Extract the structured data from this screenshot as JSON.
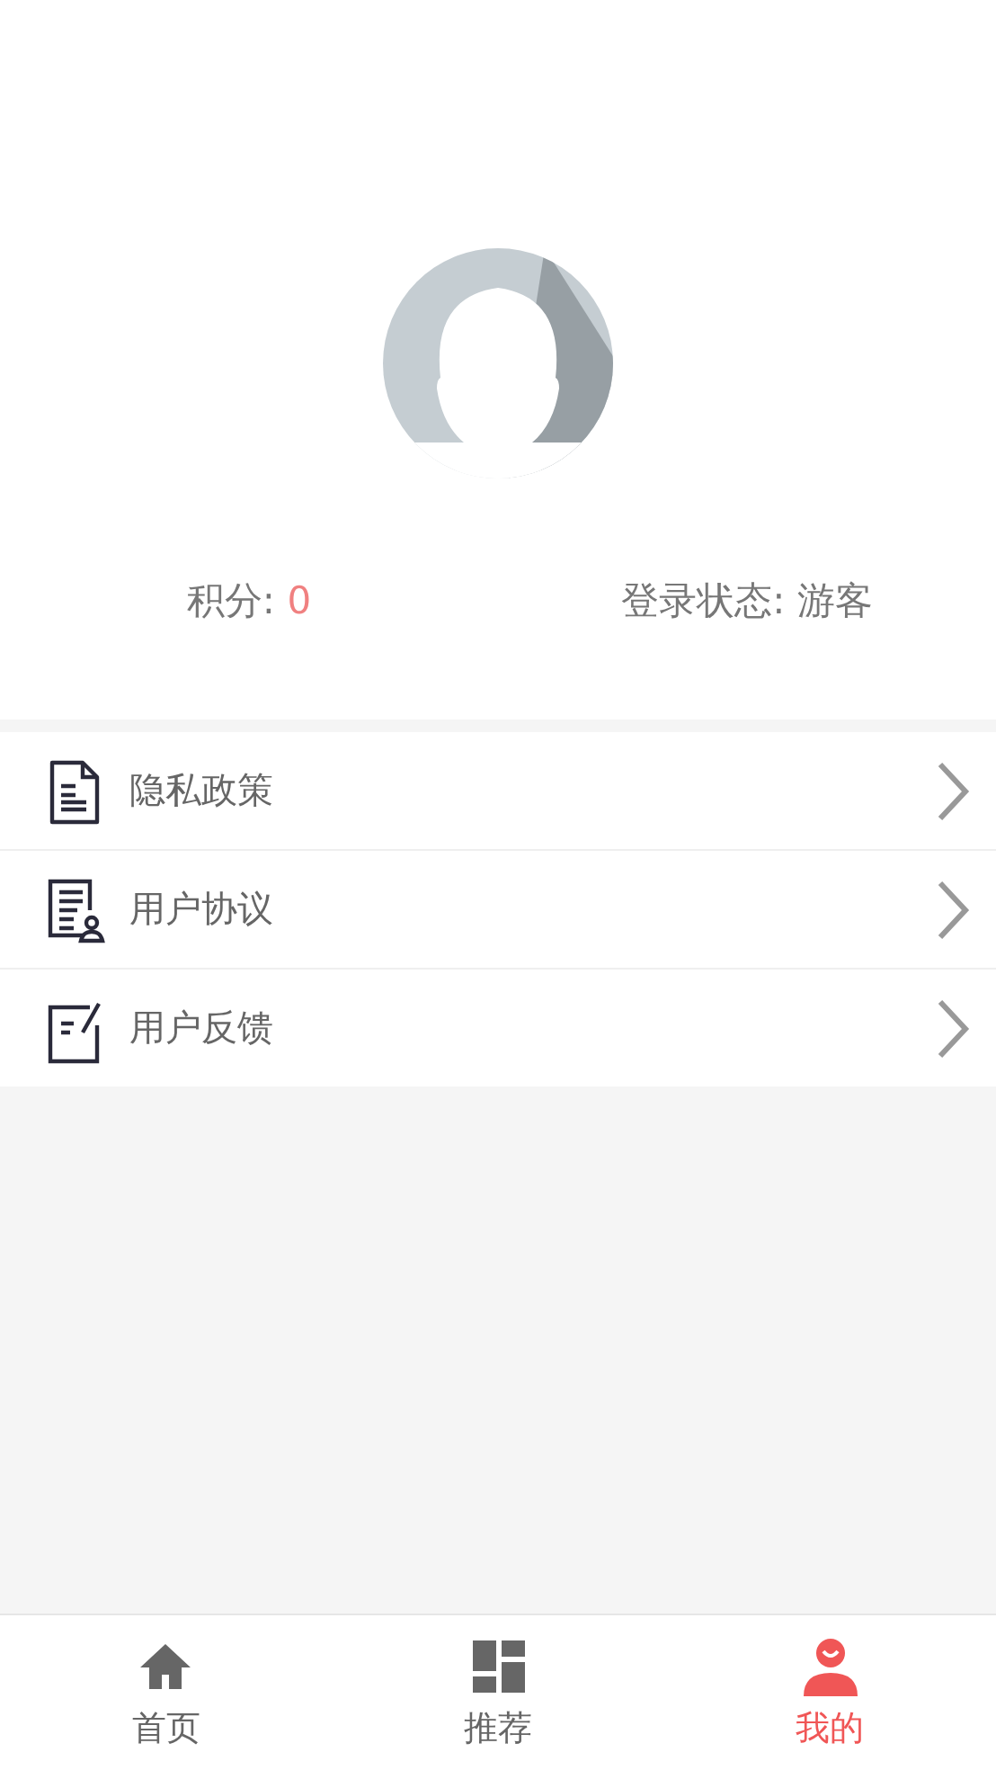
{
  "profile": {
    "stats": [
      {
        "label": "积分:",
        "value": "0",
        "highlighted": true
      },
      {
        "label": "登录状态:",
        "value": "游客",
        "highlighted": false
      }
    ]
  },
  "menu": [
    {
      "kind": "privacy",
      "label": "隐私政策"
    },
    {
      "kind": "agreement",
      "label": "用户协议"
    },
    {
      "kind": "feedback",
      "label": "用户反馈"
    }
  ],
  "tab_bar": [
    {
      "kind": "home",
      "label": "首页",
      "selected": false
    },
    {
      "kind": "grid",
      "label": "推荐",
      "selected": false
    },
    {
      "kind": "person",
      "label": "我的",
      "selected": true
    }
  ]
}
